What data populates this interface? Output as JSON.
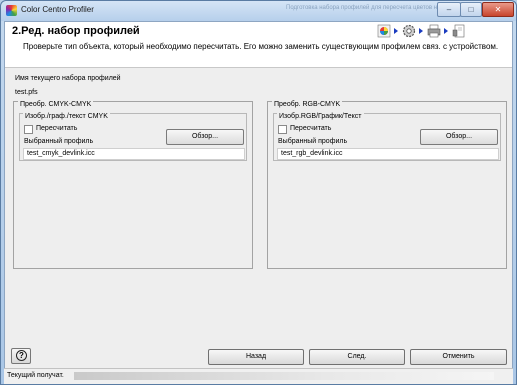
{
  "window": {
    "title": "Color Centro Profiler",
    "background_title": "Подготовка набора профилей для пересчета цветов на основе профилей",
    "minimize_glyph": "–",
    "maximize_glyph": "□",
    "close_glyph": "✕"
  },
  "header": {
    "step_title": "2.Ред. набор профилей",
    "instructions": "Проверьте тип объекта, который необходимо пересчитать. Его можно заменить существующим профилем связ. с устройством.",
    "step_icons": [
      "color-wheel-icon",
      "gear-icon",
      "printer-icon",
      "document-icon"
    ]
  },
  "profile_set": {
    "caption": "Имя текущего набора профилей",
    "value": "test.pfs"
  },
  "groups": [
    {
      "title": "Преобр. CMYK-CMYK",
      "inner_title": "Изобр./граф./текст CMYK",
      "checkbox_label": "Пересчитать",
      "checked": false,
      "browse_label": "Обзор...",
      "profile_label": "Выбранный профиль",
      "profile_value": "test_cmyk_devlink.icc"
    },
    {
      "title": "Преобр. RGB-CMYK",
      "inner_title": "Изобр.RGB/График/Текст",
      "checkbox_label": "Пересчитать",
      "checked": false,
      "browse_label": "Обзор...",
      "profile_label": "Выбранный профиль",
      "profile_value": "test_rgb_devlink.icc"
    }
  ],
  "footer": {
    "help_glyph": "?",
    "back_label": "Назад",
    "next_label": "След.",
    "cancel_label": "Отменить"
  },
  "status": {
    "text": "Текущий получат."
  },
  "colors": {
    "accent_arrow": "#1a3cc0",
    "titlebar": "#b6cfeb",
    "close_button": "#c8442c"
  }
}
